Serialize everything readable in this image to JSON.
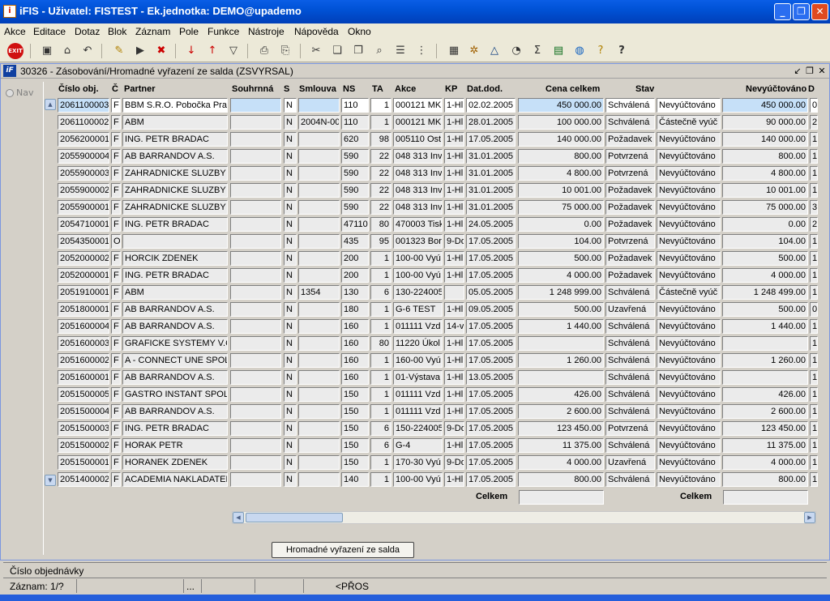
{
  "window": {
    "title": "iFIS - Uživatel: FISTEST - Ek.jednotka: DEMO@upademo",
    "icon": "ifis-app-icon"
  },
  "menu": [
    "Akce",
    "Editace",
    "Dotaz",
    "Blok",
    "Záznam",
    "Pole",
    "Funkce",
    "Nástroje",
    "Nápověda",
    "Okno"
  ],
  "toolbar": {
    "exit_label": "EXIT",
    "icons": [
      "save-icon",
      "print-preview-icon",
      "undo-icon",
      "enter-query-icon",
      "execute-query-icon",
      "cancel-query-icon",
      "sort-asc-icon",
      "sort-desc-icon",
      "filter-icon",
      "print-icon",
      "printer-setup-icon",
      "cut-icon",
      "copy-icon",
      "paste-icon",
      "find-icon",
      "list-icon",
      "tree-icon",
      "calculator-icon",
      "tools-icon",
      "warning-icon",
      "chart-icon",
      "sum-icon",
      "excel-icon",
      "globe-icon",
      "help-wizard-icon",
      "help-icon"
    ]
  },
  "form": {
    "title": "30326 - Zásobování/Hromadné vyřazení ze salda (ZSVYRSAL)",
    "nav_label": "Nav"
  },
  "columns": [
    "Číslo obj.",
    "Č",
    "Partner",
    "Souhrnná",
    "S",
    "Smlouva",
    "NS",
    "TA",
    "Akce",
    "KP",
    "Dat.dod.",
    "Cena celkem",
    "Stav",
    "Nevyúčtováno",
    "D"
  ],
  "rows": [
    {
      "cislo": "2061100003",
      "c": "F",
      "partner": "BBM S.R.O. Pobočka Prah",
      "souhrnna": "",
      "s": "N",
      "smlouva": "",
      "ns": "110",
      "ta": "1",
      "akce": "000121 MK",
      "kp": "1-Hl",
      "datum": "02.02.2005",
      "cena": "450 000.00",
      "stav": "Schválená",
      "vyuct": "Nevyúčtováno",
      "nevyuct": "450 000.00",
      "d": "0"
    },
    {
      "cislo": "2061100002",
      "c": "F",
      "partner": "ABM",
      "souhrnna": "",
      "s": "N",
      "smlouva": "2004N-00",
      "ns": "110",
      "ta": "1",
      "akce": "000121 MK",
      "kp": "1-Hl",
      "datum": "28.01.2005",
      "cena": "100 000.00",
      "stav": "Schválená",
      "vyuct": "Částečně vyúč",
      "nevyuct": "90 000.00",
      "d": "2"
    },
    {
      "cislo": "2056200001",
      "c": "F",
      "partner": "ING. PETR BRADAC",
      "souhrnna": "",
      "s": "N",
      "smlouva": "",
      "ns": "620",
      "ta": "98",
      "akce": "005110 Ost",
      "kp": "1-Hl",
      "datum": "17.05.2005",
      "cena": "140 000.00",
      "stav": "Požadavek",
      "vyuct": "Nevyúčtováno",
      "nevyuct": "140 000.00",
      "d": "1"
    },
    {
      "cislo": "2055900004",
      "c": "F",
      "partner": "AB BARRANDOV A.S.",
      "souhrnna": "",
      "s": "N",
      "smlouva": "",
      "ns": "590",
      "ta": "22",
      "akce": "048 313 Inv",
      "kp": "1-Hl",
      "datum": "31.01.2005",
      "cena": "800.00",
      "stav": "Potvrzená",
      "vyuct": "Nevyúčtováno",
      "nevyuct": "800.00",
      "d": "1"
    },
    {
      "cislo": "2055900003",
      "c": "F",
      "partner": "ZAHRADNICKE SLUZBY",
      "souhrnna": "",
      "s": "N",
      "smlouva": "",
      "ns": "590",
      "ta": "22",
      "akce": "048 313 Inv",
      "kp": "1-Hl",
      "datum": "31.01.2005",
      "cena": "4 800.00",
      "stav": "Potvrzená",
      "vyuct": "Nevyúčtováno",
      "nevyuct": "4 800.00",
      "d": "1"
    },
    {
      "cislo": "2055900002",
      "c": "F",
      "partner": "ZAHRADNICKE SLUZBY",
      "souhrnna": "",
      "s": "N",
      "smlouva": "",
      "ns": "590",
      "ta": "22",
      "akce": "048 313 Inv",
      "kp": "1-Hl",
      "datum": "31.01.2005",
      "cena": "10 001.00",
      "stav": "Požadavek",
      "vyuct": "Nevyúčtováno",
      "nevyuct": "10 001.00",
      "d": "1"
    },
    {
      "cislo": "2055900001",
      "c": "F",
      "partner": "ZAHRADNICKE SLUZBY",
      "souhrnna": "",
      "s": "N",
      "smlouva": "",
      "ns": "590",
      "ta": "22",
      "akce": "048 313 Inv",
      "kp": "1-Hl",
      "datum": "31.01.2005",
      "cena": "75 000.00",
      "stav": "Požadavek",
      "vyuct": "Nevyúčtováno",
      "nevyuct": "75 000.00",
      "d": "3"
    },
    {
      "cislo": "2054710001",
      "c": "F",
      "partner": "ING. PETR BRADAC",
      "souhrnna": "",
      "s": "N",
      "smlouva": "",
      "ns": "47110",
      "ta": "80",
      "akce": "470003 Tisk",
      "kp": "1-Hl",
      "datum": "24.05.2005",
      "cena": "0.00",
      "stav": "Požadavek",
      "vyuct": "Nevyúčtováno",
      "nevyuct": "0.00",
      "d": "2"
    },
    {
      "cislo": "2054350001",
      "c": "O",
      "partner": "",
      "souhrnna": "",
      "s": "N",
      "smlouva": "",
      "ns": "435",
      "ta": "95",
      "akce": "001323 Bor",
      "kp": "9-Do",
      "datum": "17.05.2005",
      "cena": "104.00",
      "stav": "Potvrzená",
      "vyuct": "Nevyúčtováno",
      "nevyuct": "104.00",
      "d": "1"
    },
    {
      "cislo": "2052000002",
      "c": "F",
      "partner": "HORCIK ZDENEK",
      "souhrnna": "",
      "s": "N",
      "smlouva": "",
      "ns": "200",
      "ta": "1",
      "akce": "100-00 Vyú",
      "kp": "1-Hl",
      "datum": "17.05.2005",
      "cena": "500.00",
      "stav": "Požadavek",
      "vyuct": "Nevyúčtováno",
      "nevyuct": "500.00",
      "d": "1"
    },
    {
      "cislo": "2052000001",
      "c": "F",
      "partner": "ING. PETR BRADAC",
      "souhrnna": "",
      "s": "N",
      "smlouva": "",
      "ns": "200",
      "ta": "1",
      "akce": "100-00 Vyú",
      "kp": "1-Hl",
      "datum": "17.05.2005",
      "cena": "4 000.00",
      "stav": "Požadavek",
      "vyuct": "Nevyúčtováno",
      "nevyuct": "4 000.00",
      "d": "1"
    },
    {
      "cislo": "2051910001",
      "c": "F",
      "partner": "ABM",
      "souhrnna": "",
      "s": "N",
      "smlouva": "1354",
      "ns": "130",
      "ta": "6",
      "akce": "130-224005",
      "kp": "",
      "datum": "05.05.2005",
      "cena": "1 248 999.00",
      "stav": "Schválená",
      "vyuct": "Částečně vyúč",
      "nevyuct": "1 248 499.00",
      "d": "1"
    },
    {
      "cislo": "2051800001",
      "c": "F",
      "partner": "AB BARRANDOV A.S.",
      "souhrnna": "",
      "s": "N",
      "smlouva": "",
      "ns": "180",
      "ta": "1",
      "akce": "G-6 TEST",
      "kp": "1-Hl",
      "datum": "09.05.2005",
      "cena": "500.00",
      "stav": "Uzavřená",
      "vyuct": "Nevyúčtováno",
      "nevyuct": "500.00",
      "d": "0"
    },
    {
      "cislo": "2051600004",
      "c": "F",
      "partner": "AB BARRANDOV A.S.",
      "souhrnna": "",
      "s": "N",
      "smlouva": "",
      "ns": "160",
      "ta": "1",
      "akce": "011111 Vzd",
      "kp": "14-v",
      "datum": "17.05.2005",
      "cena": "1 440.00",
      "stav": "Schválená",
      "vyuct": "Nevyúčtováno",
      "nevyuct": "1 440.00",
      "d": "1"
    },
    {
      "cislo": "2051600003",
      "c": "F",
      "partner": "GRAFICKE SYSTEMY V.C",
      "souhrnna": "",
      "s": "N",
      "smlouva": "",
      "ns": "160",
      "ta": "80",
      "akce": "11220 Úkol",
      "kp": "1-Hl",
      "datum": "17.05.2005",
      "cena": "",
      "stav": "Schválená",
      "vyuct": "Nevyúčtováno",
      "nevyuct": "",
      "d": "1"
    },
    {
      "cislo": "2051600002",
      "c": "F",
      "partner": "A - CONNECT UNE SPOL.",
      "souhrnna": "",
      "s": "N",
      "smlouva": "",
      "ns": "160",
      "ta": "1",
      "akce": "160-00 Vyú",
      "kp": "1-Hl",
      "datum": "17.05.2005",
      "cena": "1 260.00",
      "stav": "Schválená",
      "vyuct": "Nevyúčtováno",
      "nevyuct": "1 260.00",
      "d": "1"
    },
    {
      "cislo": "2051600001",
      "c": "F",
      "partner": "AB BARRANDOV A.S.",
      "souhrnna": "",
      "s": "N",
      "smlouva": "",
      "ns": "160",
      "ta": "1",
      "akce": "01-Výstava",
      "kp": "1-Hl",
      "datum": "13.05.2005",
      "cena": "",
      "stav": "Schválená",
      "vyuct": "Nevyúčtováno",
      "nevyuct": "",
      "d": "1"
    },
    {
      "cislo": "2051500005",
      "c": "F",
      "partner": "GASTRO INSTANT SPOL.",
      "souhrnna": "",
      "s": "N",
      "smlouva": "",
      "ns": "150",
      "ta": "1",
      "akce": "011111 Vzd",
      "kp": "1-Hl",
      "datum": "17.05.2005",
      "cena": "426.00",
      "stav": "Schválená",
      "vyuct": "Nevyúčtováno",
      "nevyuct": "426.00",
      "d": "1"
    },
    {
      "cislo": "2051500004",
      "c": "F",
      "partner": "AB BARRANDOV A.S.",
      "souhrnna": "",
      "s": "N",
      "smlouva": "",
      "ns": "150",
      "ta": "1",
      "akce": "011111 Vzd",
      "kp": "1-Hl",
      "datum": "17.05.2005",
      "cena": "2 600.00",
      "stav": "Schválená",
      "vyuct": "Nevyúčtováno",
      "nevyuct": "2 600.00",
      "d": "1"
    },
    {
      "cislo": "2051500003",
      "c": "F",
      "partner": "ING. PETR BRADAC",
      "souhrnna": "",
      "s": "N",
      "smlouva": "",
      "ns": "150",
      "ta": "6",
      "akce": "150-224005",
      "kp": "9-Do",
      "datum": "17.05.2005",
      "cena": "123 450.00",
      "stav": "Potvrzená",
      "vyuct": "Nevyúčtováno",
      "nevyuct": "123 450.00",
      "d": "1"
    },
    {
      "cislo": "2051500002",
      "c": "F",
      "partner": "HORAK PETR",
      "souhrnna": "",
      "s": "N",
      "smlouva": "",
      "ns": "150",
      "ta": "6",
      "akce": "G-4",
      "kp": "1-Hl",
      "datum": "17.05.2005",
      "cena": "11 375.00",
      "stav": "Schválená",
      "vyuct": "Nevyúčtováno",
      "nevyuct": "11 375.00",
      "d": "1"
    },
    {
      "cislo": "2051500001",
      "c": "F",
      "partner": "HORANEK ZDENEK",
      "souhrnna": "",
      "s": "N",
      "smlouva": "",
      "ns": "150",
      "ta": "1",
      "akce": "170-30 Vyú",
      "kp": "9-Do",
      "datum": "17.05.2005",
      "cena": "4 000.00",
      "stav": "Uzavřená",
      "vyuct": "Nevyúčtováno",
      "nevyuct": "4 000.00",
      "d": "1"
    },
    {
      "cislo": "2051400002",
      "c": "F",
      "partner": "ACADEMIA NAKLADATEL",
      "souhrnna": "",
      "s": "N",
      "smlouva": "",
      "ns": "140",
      "ta": "1",
      "akce": "100-00 Vyú",
      "kp": "1-Hl",
      "datum": "17.05.2005",
      "cena": "800.00",
      "stav": "Schválená",
      "vyuct": "Nevyúčtováno",
      "nevyuct": "800.00",
      "d": "1"
    }
  ],
  "totals": {
    "label_1": "Celkem",
    "label_2": "Celkem",
    "value_1": "",
    "value_2": ""
  },
  "action_button": "Hromadné vyřazení ze salda",
  "hint": "Číslo objednávky",
  "status": {
    "record": "Záznam: 1/?",
    "dots": "...",
    "mode": "<PŘOS"
  },
  "colors": {
    "titlebar": "#0052d6",
    "current_row_highlight": "#c6e0f8",
    "field_bg": "#ffffff",
    "readonly_bg": "#ebebeb"
  }
}
